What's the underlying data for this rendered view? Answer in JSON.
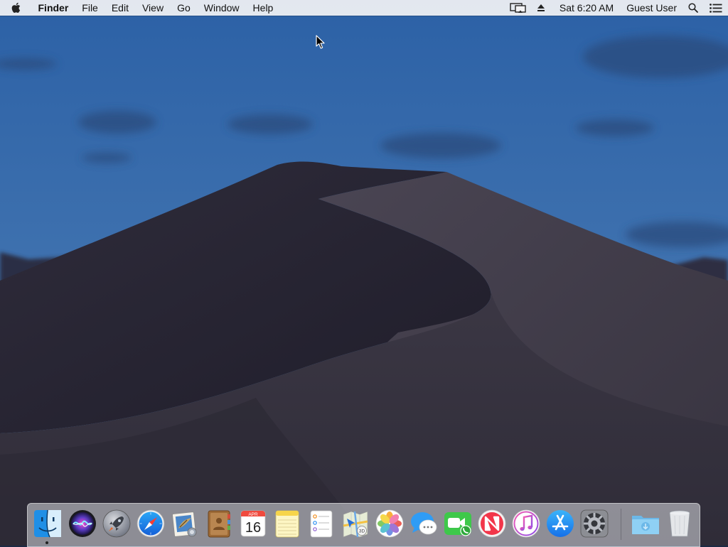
{
  "menubar": {
    "apple_icon": "apple-logo-icon",
    "app_name": "Finder",
    "menus": [
      "File",
      "Edit",
      "View",
      "Go",
      "Window",
      "Help"
    ],
    "status": {
      "display_icon": "airplay-display-icon",
      "eject_icon": "eject-icon",
      "clock": "Sat 6:20 AM",
      "user": "Guest User",
      "spotlight_icon": "spotlight-search-icon",
      "notification_icon": "notification-center-icon"
    }
  },
  "dock": {
    "apps": [
      {
        "name": "Finder",
        "icon": "finder-icon",
        "running": true
      },
      {
        "name": "Siri",
        "icon": "siri-icon"
      },
      {
        "name": "Launchpad",
        "icon": "launchpad-icon"
      },
      {
        "name": "Safari",
        "icon": "safari-icon"
      },
      {
        "name": "Mail",
        "icon": "mail-icon"
      },
      {
        "name": "Contacts",
        "icon": "contacts-icon"
      },
      {
        "name": "Calendar",
        "icon": "calendar-icon",
        "month": "APR",
        "day": "16"
      },
      {
        "name": "Notes",
        "icon": "notes-icon"
      },
      {
        "name": "Reminders",
        "icon": "reminders-icon"
      },
      {
        "name": "Maps",
        "icon": "maps-icon",
        "badge": "3D"
      },
      {
        "name": "Photos",
        "icon": "photos-icon"
      },
      {
        "name": "Messages",
        "icon": "messages-icon"
      },
      {
        "name": "FaceTime",
        "icon": "facetime-icon"
      },
      {
        "name": "News",
        "icon": "news-icon"
      },
      {
        "name": "iTunes",
        "icon": "itunes-icon"
      },
      {
        "name": "App Store",
        "icon": "app-store-icon"
      },
      {
        "name": "System Preferences",
        "icon": "system-preferences-icon"
      },
      {
        "name": "Downloads",
        "icon": "downloads-folder-icon"
      },
      {
        "name": "Trash",
        "icon": "trash-icon"
      }
    ]
  },
  "colors": {
    "sky_top": "#2d63a8",
    "sky_bottom": "#4a79b3",
    "dune_dark": "#2a2836",
    "dune_light": "#3d3947",
    "menubar_bg": "#f3f3f5"
  }
}
